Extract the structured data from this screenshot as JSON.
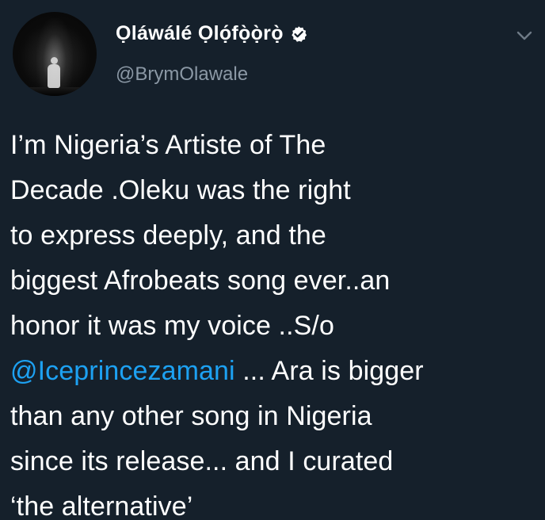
{
  "header": {
    "display_name": "Ọláwálé Ọlọ́fọ̀ọ̀rọ̀",
    "handle": "@BrymOlawale",
    "verified": true
  },
  "icons": {
    "verified": "verified-badge-icon",
    "menu": "chevron-down-icon",
    "avatar": "profile-photo"
  },
  "colors": {
    "background": "#15202b",
    "text": "#ffffff",
    "secondary_text": "#8b98a5",
    "mention": "#1da1f2"
  },
  "tweet": {
    "line1": "I’m Nigeria’s Artiste of The",
    "line2": "Decade .Oleku was the right",
    "line3": "to express deeply, and the",
    "line4": "biggest Afrobeats song ever..an",
    "line5": "honor it was my voice ..S/o",
    "line6_mention": "@Iceprincezamani",
    "line6_rest": " ... Ara is bigger",
    "line7": "than any other song in Nigeria",
    "line8": "since its release... and I curated",
    "line9": "‘the alternative’"
  }
}
